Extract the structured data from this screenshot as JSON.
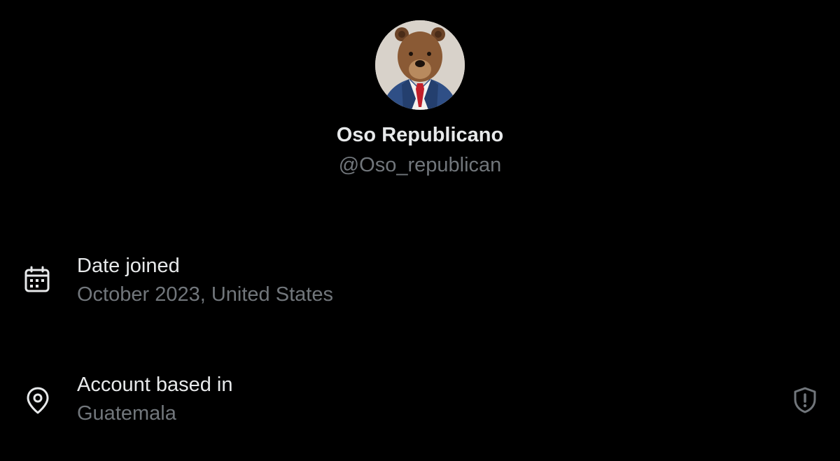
{
  "profile": {
    "display_name": "Oso Republicano",
    "handle": "@Oso_republican",
    "avatar_icon": "avatar-bear-in-suit"
  },
  "about": {
    "date_joined": {
      "icon": "calendar-icon",
      "label": "Date joined",
      "value": "October 2023, United States"
    },
    "account_location": {
      "icon": "location-pin-icon",
      "label": "Account based in",
      "value": "Guatemala",
      "badge_icon": "shield-alert-icon"
    }
  },
  "colors": {
    "background": "#000000",
    "primary_text": "#e7e9ea",
    "secondary_text": "#71767b"
  }
}
